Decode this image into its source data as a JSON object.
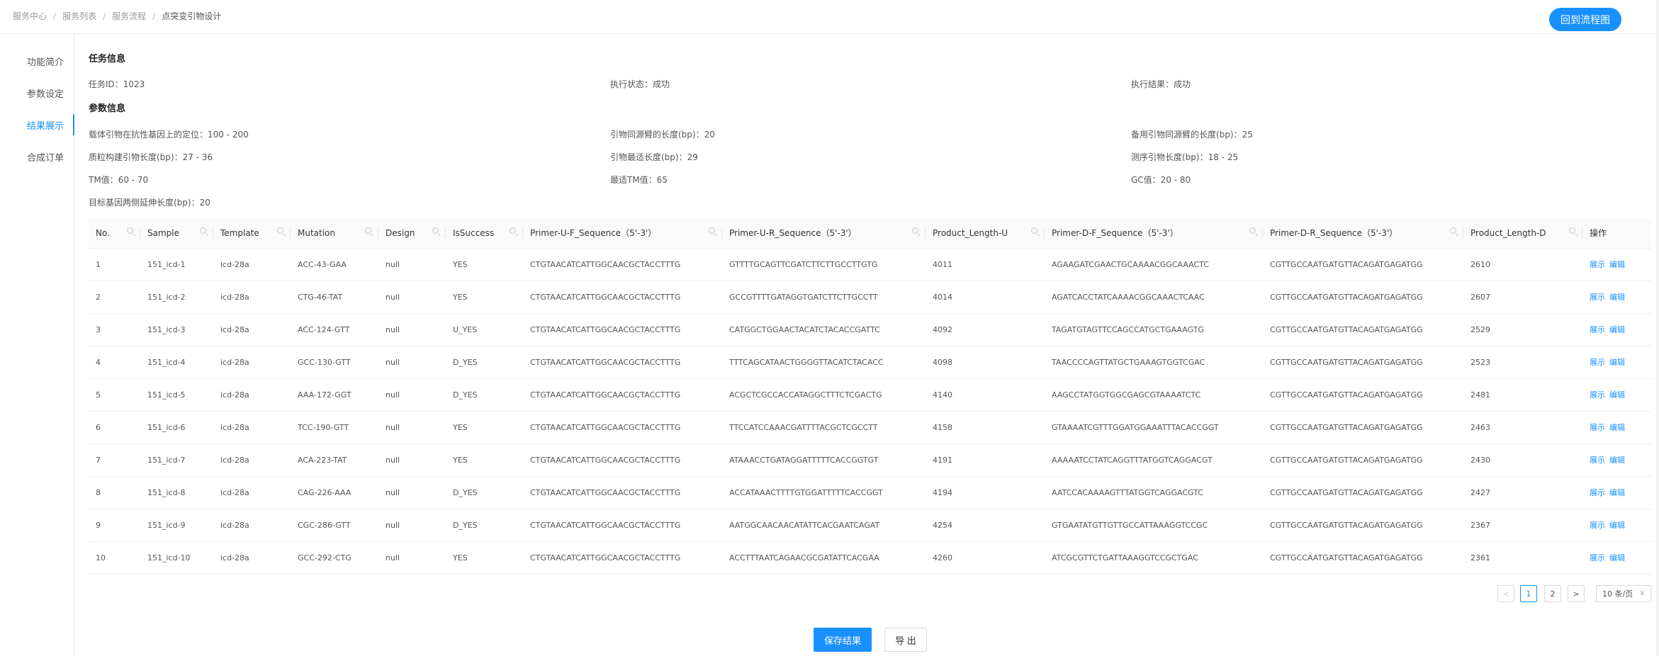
{
  "breadcrumb": {
    "items": [
      "服务中心",
      "服务列表",
      "服务流程",
      "点突变引物设计"
    ],
    "separator": "/"
  },
  "header": {
    "back_button": "回到流程图"
  },
  "sidebar": {
    "items": [
      {
        "label": "功能简介",
        "active": false
      },
      {
        "label": "参数设定",
        "active": false
      },
      {
        "label": "结果展示",
        "active": true
      },
      {
        "label": "合成订单",
        "active": false
      }
    ]
  },
  "task_info": {
    "title": "任务信息",
    "task_id": "任务ID：1023",
    "exec_status": "执行状态：成功",
    "exec_result": "执行结果：成功"
  },
  "param_info": {
    "title": "参数信息",
    "items": [
      "载体引物在抗性基因上的定位：100 - 200",
      "引物同源臂的长度(bp)：20",
      "备用引物同源臂的长度(bp)：25",
      "质粒构建引物长度(bp)：27 - 36",
      "引物最适长度(bp)：29",
      "测序引物长度(bp)：18 - 25",
      "TM值：60 - 70",
      "最适TM值：65",
      "GC值：20 - 80",
      "目标基因两侧延伸长度(bp)：20"
    ]
  },
  "table": {
    "columns": [
      "No.",
      "Sample",
      "Template",
      "Mutation",
      "Design",
      "IsSuccess",
      "Primer-U-F_Sequence（5'-3'）",
      "Primer-U-R_Sequence（5'-3'）",
      "Product_Length-U",
      "Primer-D-F_Sequence（5'-3'）",
      "Primer-D-R_Sequence（5'-3'）",
      "Product_Length-D",
      "操作"
    ],
    "actions": {
      "view": "展示",
      "edit": "编辑"
    },
    "rows": [
      [
        "1",
        "151_icd-1",
        "icd-28a",
        "ACC-43-GAA",
        "null",
        "YES",
        "CTGTAACATCATTGGCAACGCTACCTTTG",
        "GTTTTGCAGTTCGATCTTCTTGCCTTGTG",
        "4011",
        "AGAAGATCGAACTGCAAAACGGCAAACTC",
        "CGTTGCCAATGATGTTACAGATGAGATGG",
        "2610"
      ],
      [
        "2",
        "151_icd-2",
        "icd-28a",
        "CTG-46-TAT",
        "null",
        "YES",
        "CTGTAACATCATTGGCAACGCTACCTTTG",
        "GCCGTTTTGATAGGTGATCTTCTTGCCTT",
        "4014",
        "AGATCACCTATCAAAACGGCAAACTCAAC",
        "CGTTGCCAATGATGTTACAGATGAGATGG",
        "2607"
      ],
      [
        "3",
        "151_icd-3",
        "icd-28a",
        "ACC-124-GTT",
        "null",
        "U_YES",
        "CTGTAACATCATTGGCAACGCTACCTTTG",
        "CATGGCTGGAACTACATCTACACCGATTC",
        "4092",
        "TAGATGTAGTTCCAGCCATGCTGAAAGTG",
        "CGTTGCCAATGATGTTACAGATGAGATGG",
        "2529"
      ],
      [
        "4",
        "151_icd-4",
        "icd-28a",
        "GCC-130-GTT",
        "null",
        "D_YES",
        "CTGTAACATCATTGGCAACGCTACCTTTG",
        "TTTCAGCATAACTGGGGTTACATCTACACC",
        "4098",
        "TAACCCCAGTTATGCTGAAAGTGGTCGAC",
        "CGTTGCCAATGATGTTACAGATGAGATGG",
        "2523"
      ],
      [
        "5",
        "151_icd-5",
        "icd-28a",
        "AAA-172-GGT",
        "null",
        "D_YES",
        "CTGTAACATCATTGGCAACGCTACCTTTG",
        "ACGCTCGCCACCATAGGCTTTCTCGACTG",
        "4140",
        "AAGCCTATGGTGGCGAGCGTAAAATCTC",
        "CGTTGCCAATGATGTTACAGATGAGATGG",
        "2481"
      ],
      [
        "6",
        "151_icd-6",
        "icd-28a",
        "TCC-190-GTT",
        "null",
        "YES",
        "CTGTAACATCATTGGCAACGCTACCTTTG",
        "TTCCATCCAAACGATTTTACGCTCGCCTT",
        "4158",
        "GTAAAATCGTTTGGATGGAAATTTACACCGGT",
        "CGTTGCCAATGATGTTACAGATGAGATGG",
        "2463"
      ],
      [
        "7",
        "151_icd-7",
        "icd-28a",
        "ACA-223-TAT",
        "null",
        "YES",
        "CTGTAACATCATTGGCAACGCTACCTTTG",
        "ATAAACCTGATAGGATTTTTCACCGGTGT",
        "4191",
        "AAAAATCCTATCAGGTTTATGGTCAGGACGT",
        "CGTTGCCAATGATGTTACAGATGAGATGG",
        "2430"
      ],
      [
        "8",
        "151_icd-8",
        "icd-28a",
        "CAG-226-AAA",
        "null",
        "D_YES",
        "CTGTAACATCATTGGCAACGCTACCTTTG",
        "ACCATAAACTTTTGTGGATTTTTCACCGGT",
        "4194",
        "AATCCACAAAAGTTTATGGTCAGGACGTC",
        "CGTTGCCAATGATGTTACAGATGAGATGG",
        "2427"
      ],
      [
        "9",
        "151_icd-9",
        "icd-28a",
        "CGC-286-GTT",
        "null",
        "D_YES",
        "CTGTAACATCATTGGCAACGCTACCTTTG",
        "AATGGCAACAACATATTCACGAATCAGAT",
        "4254",
        "GTGAATATGTTGTTGCCATTAAAGGTCCGC",
        "CGTTGCCAATGATGTTACAGATGAGATGG",
        "2367"
      ],
      [
        "10",
        "151_icd-10",
        "icd-28a",
        "GCC-292-CTG",
        "null",
        "YES",
        "CTGTAACATCATTGGCAACGCTACCTTTG",
        "ACCTTTAATCAGAACGCGATATTCACGAA",
        "4260",
        "ATCGCGTTCTGATTAAAGGTCCGCTGAC",
        "CGTTGCCAATGATGTTACAGATGAGATGG",
        "2361"
      ]
    ]
  },
  "pagination": {
    "prev": "<",
    "next": ">",
    "pages": [
      "1",
      "2"
    ],
    "current": "1",
    "page_size": "10 条/页",
    "page_size_chevron": "∨"
  },
  "footer": {
    "save_button": "保存结果",
    "export_button": "导 出"
  },
  "colors": {
    "primary": "#1890ff",
    "text": "#333333",
    "muted": "#999999",
    "border": "#eeeeee"
  }
}
